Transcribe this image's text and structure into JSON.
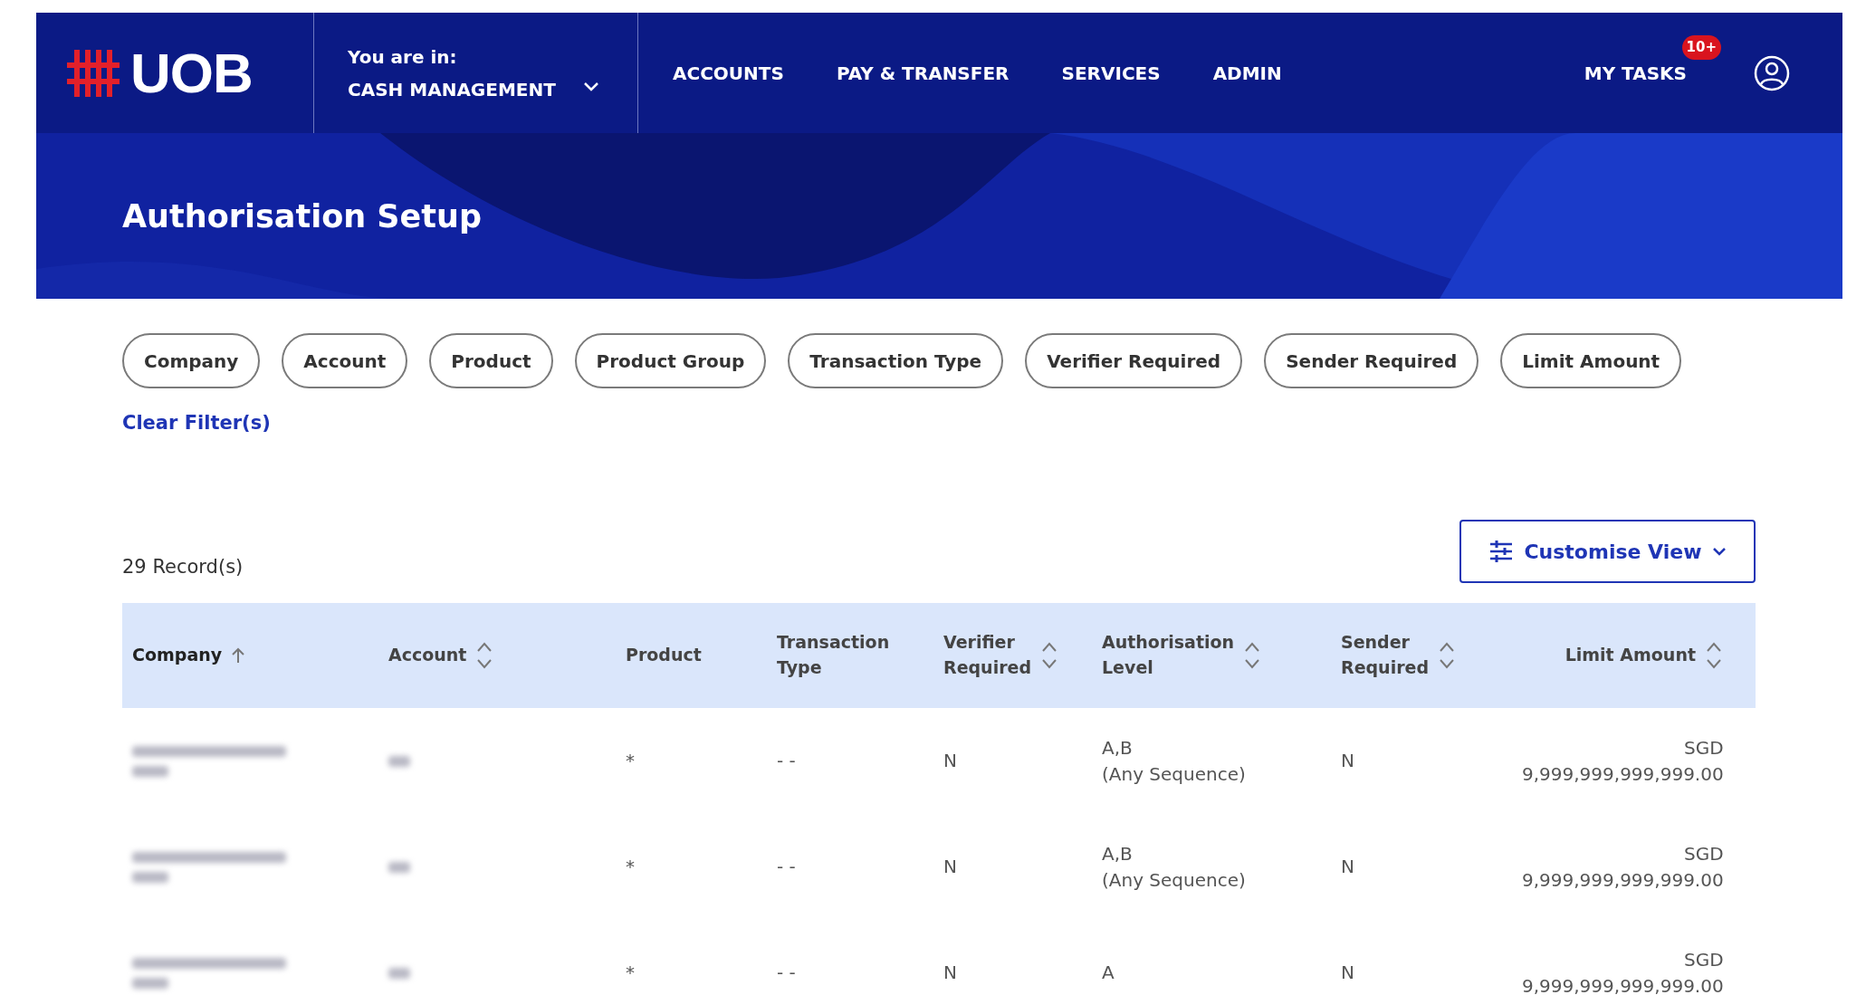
{
  "header": {
    "logo_text": "UOB",
    "context_label": "You are in:",
    "context_value": "CASH MANAGEMENT",
    "nav": [
      {
        "label": "ACCOUNTS"
      },
      {
        "label": "PAY & TRANSFER"
      },
      {
        "label": "SERVICES"
      },
      {
        "label": "ADMIN"
      }
    ],
    "tasks": {
      "label": "MY TASKS",
      "badge": "10+"
    }
  },
  "page_title": "Authorisation Setup",
  "filters": [
    {
      "label": "Company"
    },
    {
      "label": "Account"
    },
    {
      "label": "Product"
    },
    {
      "label": "Product Group"
    },
    {
      "label": "Transaction Type"
    },
    {
      "label": "Verifier Required"
    },
    {
      "label": "Sender Required"
    },
    {
      "label": "Limit Amount"
    }
  ],
  "clear_filters": "Clear Filter(s)",
  "record_count": "29 Record(s)",
  "customise_view": "Customise View",
  "table": {
    "columns": [
      {
        "label": "Company",
        "sortable": true,
        "sorted_ascending": true
      },
      {
        "label": "Account",
        "sortable": true,
        "sorted_ascending": false
      },
      {
        "label": "Product",
        "sortable": false,
        "sorted_ascending": false
      },
      {
        "label": "Transaction Type",
        "sortable": false,
        "sorted_ascending": false
      },
      {
        "label": "Verifier Required",
        "sortable": true,
        "sorted_ascending": false
      },
      {
        "label": "Authorisation Level",
        "sortable": true,
        "sorted_ascending": false
      },
      {
        "label": "Sender Required",
        "sortable": true,
        "sorted_ascending": false
      },
      {
        "label": "Limit Amount",
        "sortable": true,
        "sorted_ascending": false
      }
    ],
    "rows": [
      {
        "product": "*",
        "transaction_type": "- -",
        "verifier_required": "N",
        "authorisation_level": "A,B",
        "sequence": "(Any Sequence)",
        "sender_required": "N",
        "currency": "SGD",
        "limit": "9,999,999,999,999.00"
      },
      {
        "product": "*",
        "transaction_type": "- -",
        "verifier_required": "N",
        "authorisation_level": "A,B",
        "sequence": "(Any Sequence)",
        "sender_required": "N",
        "currency": "SGD",
        "limit": "9,999,999,999,999.00"
      },
      {
        "product": "*",
        "transaction_type": "- -",
        "verifier_required": "N",
        "authorisation_level": "A",
        "sender_required": "N",
        "currency": "SGD",
        "limit": "9,999,999,999,999.00"
      }
    ]
  }
}
